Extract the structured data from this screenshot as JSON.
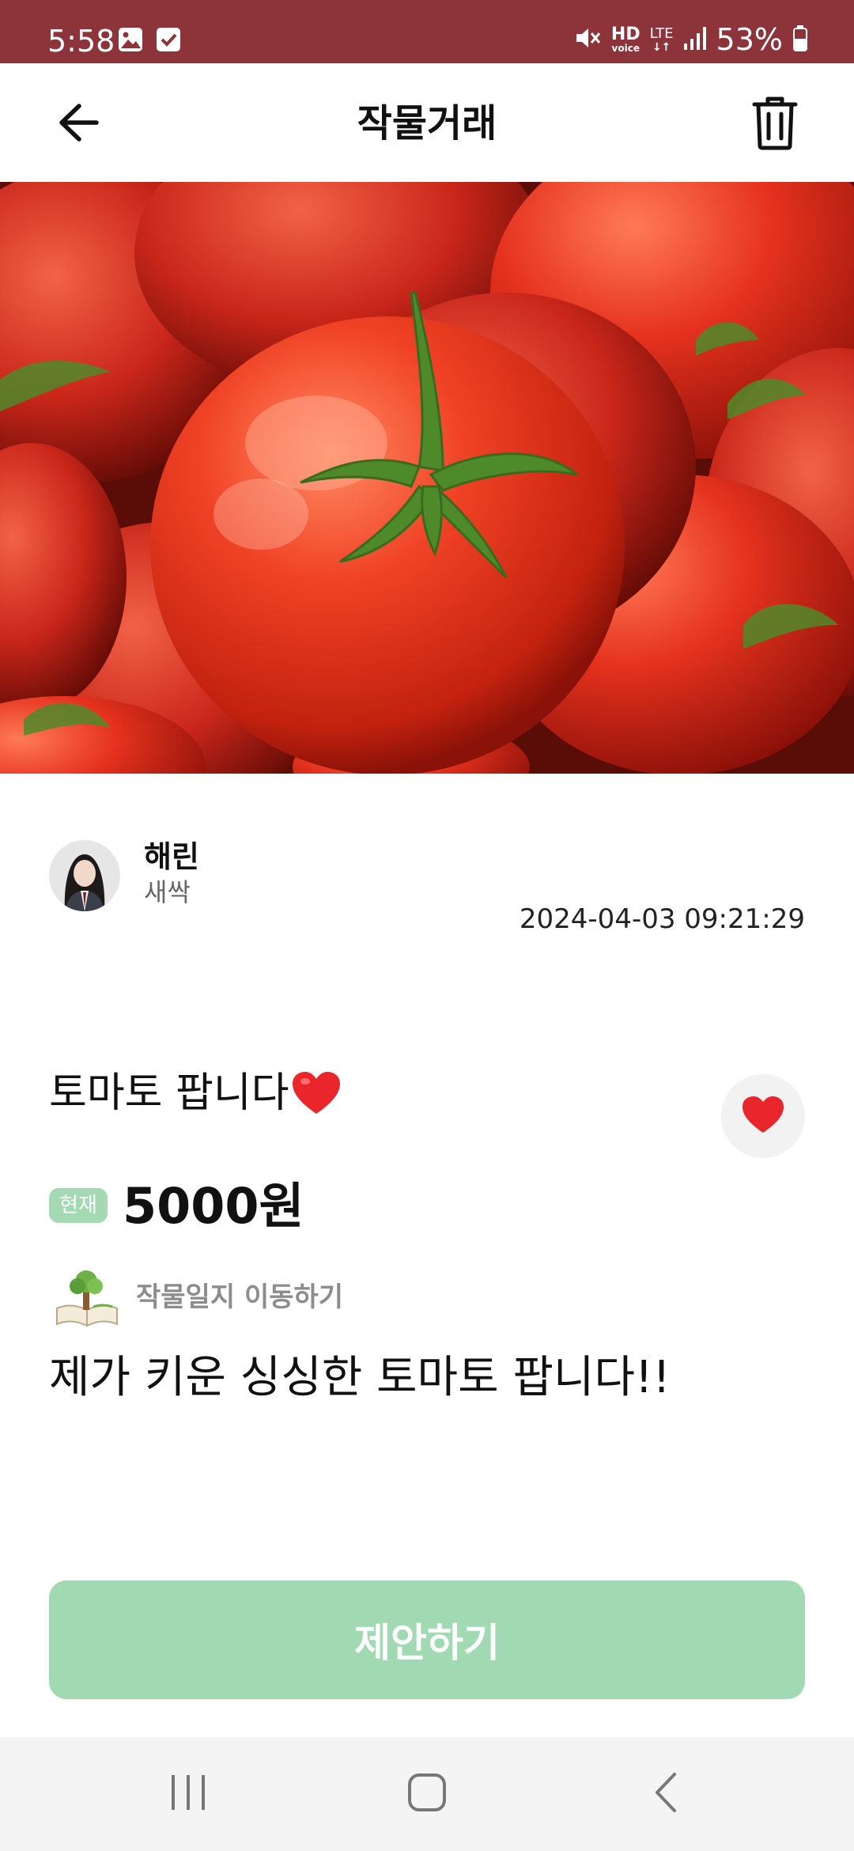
{
  "status_bar": {
    "time": "5:58",
    "hd_label": "HD",
    "voice_label": "voice",
    "lte_label": "LTE",
    "battery_percent": "53%",
    "background_color": "#8d333a",
    "icons": [
      "gallery-notification-icon",
      "checkbox-notification-icon",
      "mute-icon",
      "signal-icon",
      "battery-icon"
    ]
  },
  "header": {
    "title": "작물거래",
    "icons": [
      "back-arrow-icon",
      "trash-icon"
    ]
  },
  "hero_image": {
    "subject": "tomato-photo"
  },
  "seller": {
    "name": "해린",
    "level": "새싹"
  },
  "post": {
    "date": "2024-04-03 09:21:29",
    "title": "토마토 팝니다",
    "price_badge": "현재",
    "price": "5000원",
    "diary_link": "작물일지 이동하기",
    "body": "제가 키운 싱싱한 토마토 팝니다!!",
    "liked": true,
    "heart_color": "#e8262b"
  },
  "actions": {
    "offer_button": "제안하기",
    "offer_color": "#a1d9b3"
  },
  "nav_bar": {
    "icons": [
      "recent-apps-icon",
      "home-icon",
      "nav-back-icon"
    ]
  }
}
